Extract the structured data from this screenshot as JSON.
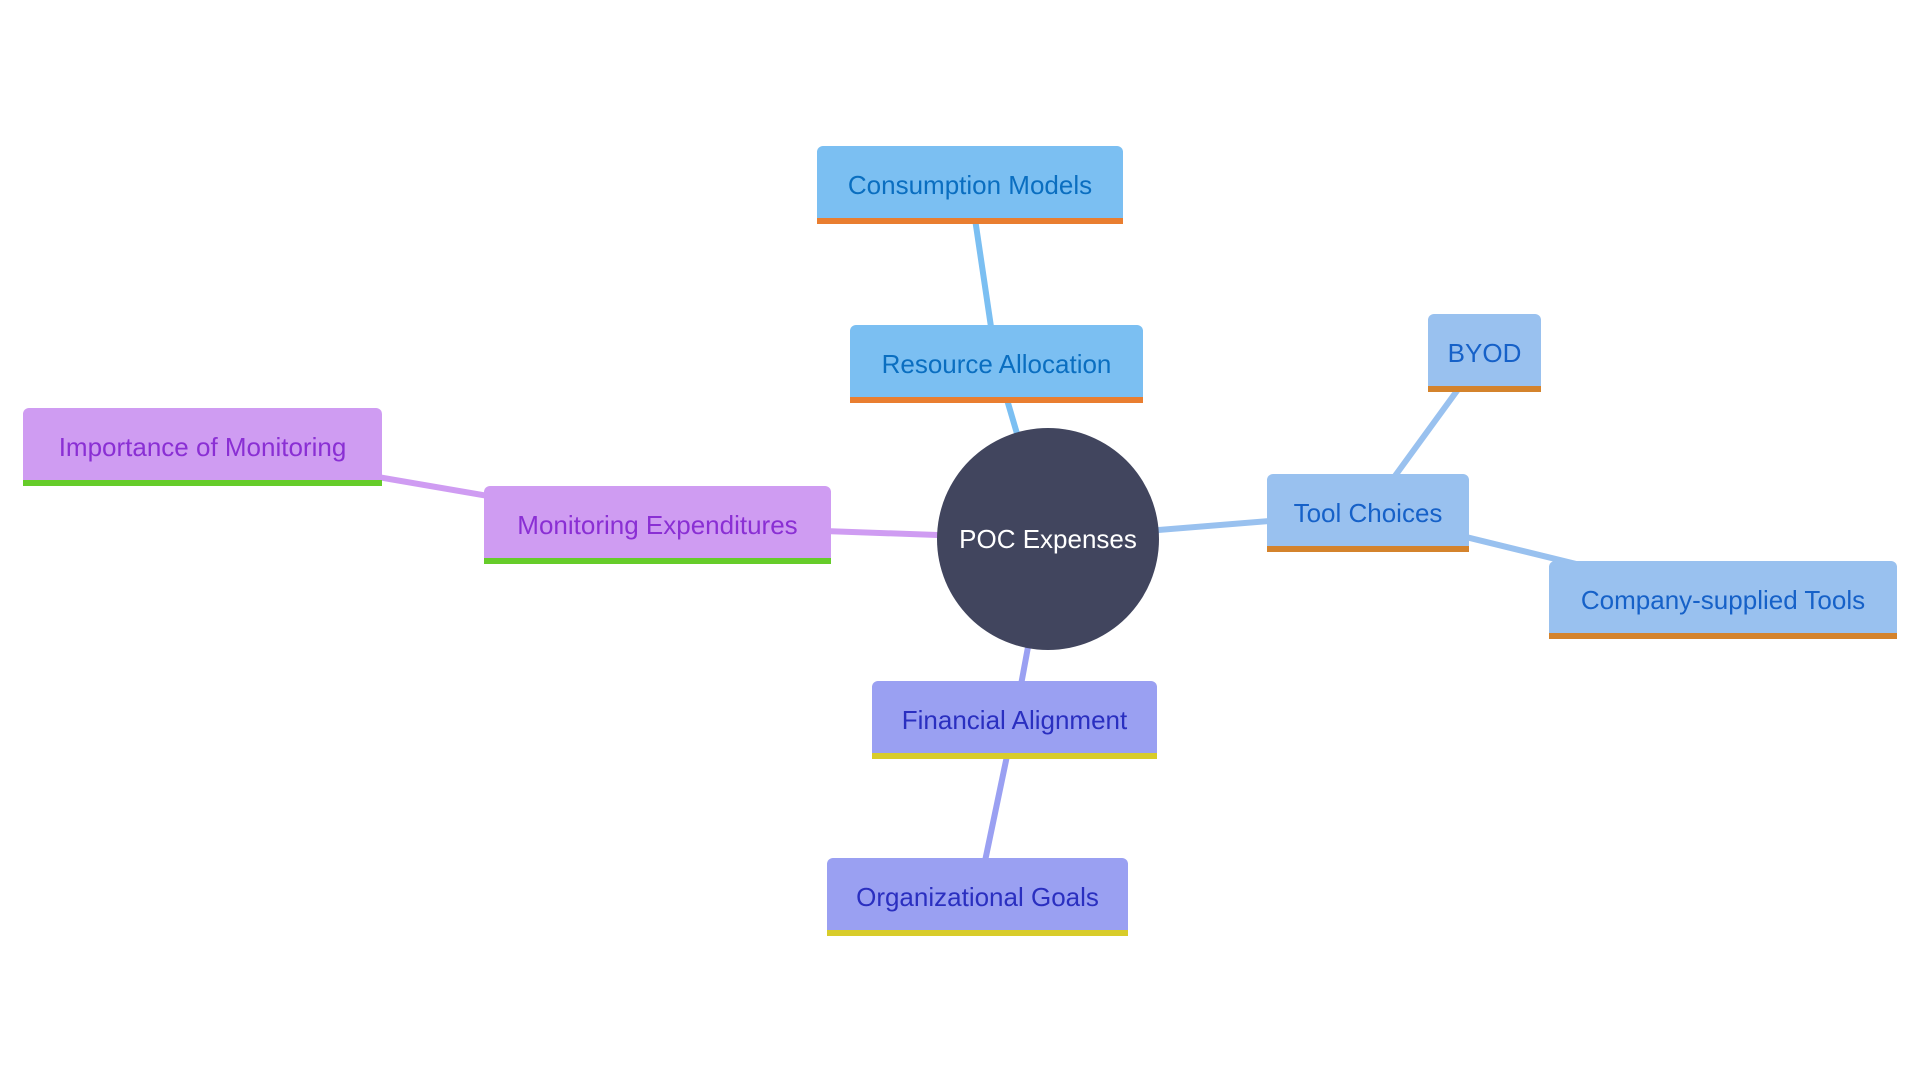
{
  "diagram": {
    "type": "mindmap",
    "root": {
      "id": "root",
      "label": "POC Expenses",
      "fill": "#41455e",
      "text_color": "#ffffff"
    },
    "nodes": [
      {
        "id": "resource-allocation",
        "label": "Resource Allocation",
        "parent": "root",
        "fill": "#7bbff2",
        "text_color": "#0a6ec0",
        "accent": "#e97e30",
        "edge": "#7bbff2"
      },
      {
        "id": "consumption-models",
        "label": "Consumption Models",
        "parent": "resource-allocation",
        "fill": "#7bbff2",
        "text_color": "#0a6ec0",
        "accent": "#e97e30",
        "edge": "#7bbff2"
      },
      {
        "id": "tool-choices",
        "label": "Tool Choices",
        "parent": "root",
        "fill": "#99c1ef",
        "text_color": "#1661c8",
        "accent": "#d4832c",
        "edge": "#99c1ef"
      },
      {
        "id": "byod",
        "label": "BYOD",
        "parent": "tool-choices",
        "fill": "#99c1ef",
        "text_color": "#1661c8",
        "accent": "#d4832c",
        "edge": "#99c1ef"
      },
      {
        "id": "company-supplied-tools",
        "label": "Company-supplied Tools",
        "parent": "tool-choices",
        "fill": "#99c1ef",
        "text_color": "#1661c8",
        "accent": "#d4832c",
        "edge": "#99c1ef"
      },
      {
        "id": "monitoring-expenditures",
        "label": "Monitoring Expenditures",
        "parent": "root",
        "fill": "#cf9cf2",
        "text_color": "#8a2fd4",
        "accent": "#66cc2a",
        "edge": "#cf9cf2"
      },
      {
        "id": "importance-of-monitoring",
        "label": "Importance of Monitoring",
        "parent": "monitoring-expenditures",
        "fill": "#cf9cf2",
        "text_color": "#8a2fd4",
        "accent": "#66cc2a",
        "edge": "#cf9cf2"
      },
      {
        "id": "financial-alignment",
        "label": "Financial Alignment",
        "parent": "root",
        "fill": "#9aa0f2",
        "text_color": "#2a2fc0",
        "accent": "#d8cc2a",
        "edge": "#9aa0f2"
      },
      {
        "id": "organizational-goals",
        "label": "Organizational Goals",
        "parent": "financial-alignment",
        "fill": "#9aa0f2",
        "text_color": "#2a2fc0",
        "accent": "#d8cc2a",
        "edge": "#9aa0f2"
      }
    ]
  }
}
